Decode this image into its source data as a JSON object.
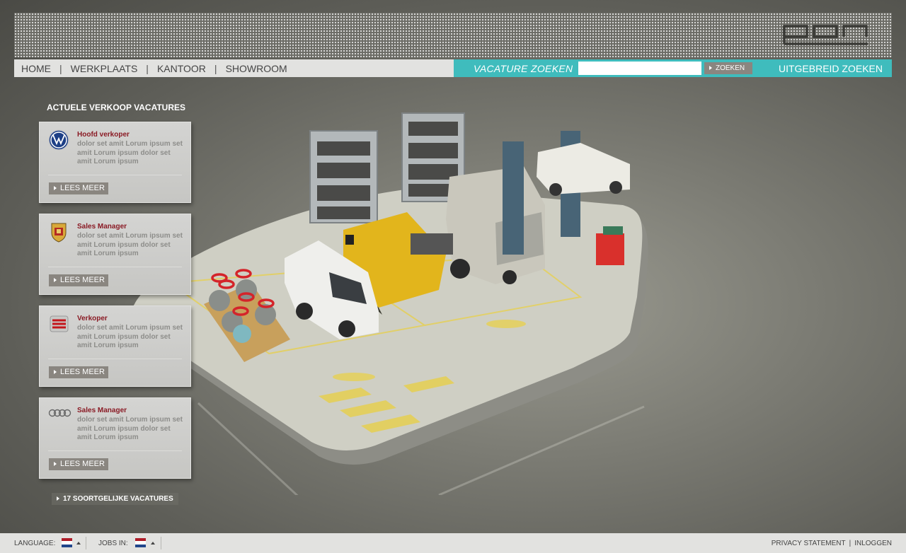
{
  "header": {
    "logo_text": "pon"
  },
  "nav": {
    "links": [
      "HOME",
      "WERKPLAATS",
      "KANTOOR",
      "SHOWROOM"
    ],
    "separator": "|"
  },
  "search": {
    "label": "VACATURE ZOEKEN",
    "input_value": "",
    "button_label": "ZOEKEN",
    "advanced_label": "UITGEBREID ZOEKEN"
  },
  "sidebar": {
    "title": "ACTUELE VERKOOP VACATURES",
    "more_label": "LEES MEER",
    "cards": [
      {
        "brand": "volkswagen-logo-icon",
        "title": "Hoofd verkoper",
        "desc": "dolor set amit Lorum ipsum set amit Lorum ipsum dolor set amit Lorum ipsum"
      },
      {
        "brand": "porsche-crest-icon",
        "title": "Sales Manager",
        "desc": "dolor set amit Lorum ipsum set amit Lorum ipsum dolor set amit Lorum ipsum"
      },
      {
        "brand": "seat-logo-icon",
        "title": "Verkoper",
        "desc": "dolor set amit Lorum ipsum set amit Lorum ipsum dolor set amit Lorum ipsum"
      },
      {
        "brand": "audi-rings-icon",
        "title": "Sales Manager",
        "desc": "dolor set amit Lorum ipsum set amit Lorum ipsum dolor set amit Lorum ipsum"
      }
    ],
    "similar_label": "17 SOORTGELIJKE VACATURES"
  },
  "footer": {
    "language_label": "LANGUAGE:",
    "jobs_label": "JOBS IN:",
    "privacy_label": "PRIVACY STATEMENT",
    "separator": "|",
    "login_label": "INLOGGEN"
  },
  "colors": {
    "accent": "#3fbcbd",
    "title_red": "#8a1a24",
    "button_grey": "#8a8680"
  }
}
